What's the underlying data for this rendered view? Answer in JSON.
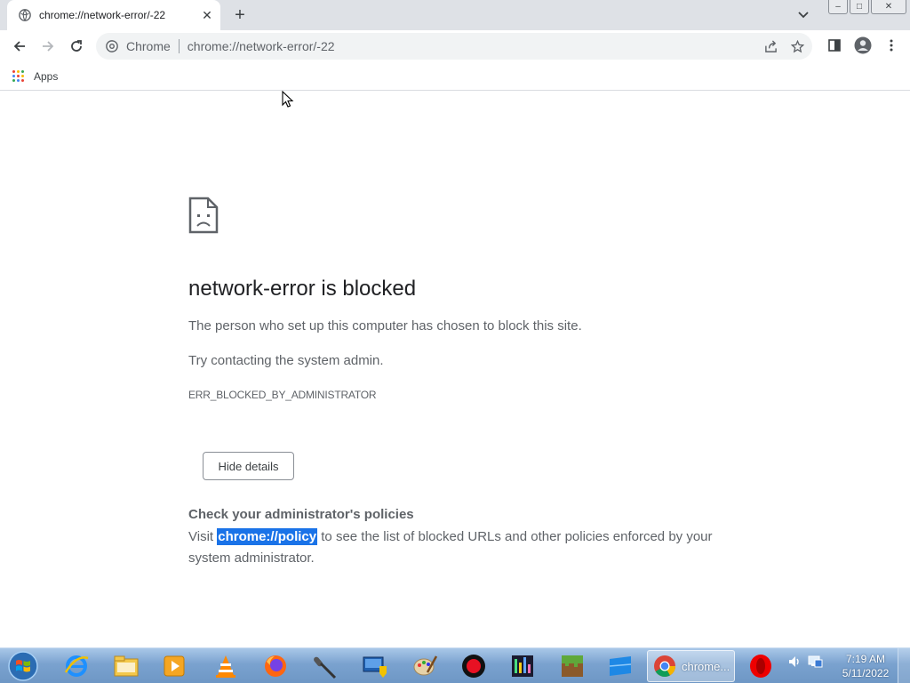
{
  "window": {
    "minimize": "–",
    "maximize": "□",
    "close": "✕"
  },
  "tab": {
    "title": "chrome://network-error/-22",
    "close": "✕",
    "new_tab": "+"
  },
  "omnibox": {
    "chip": "Chrome",
    "url": "chrome://network-error/-22"
  },
  "bookmarks": {
    "apps_label": "Apps"
  },
  "page": {
    "heading": "network-error is blocked",
    "p1": "The person who set up this computer has chosen to block this site.",
    "p2": "Try contacting the system admin.",
    "error_code": "ERR_BLOCKED_BY_ADMINISTRATOR",
    "details_button": "Hide details",
    "details_title": "Check your administrator's policies",
    "details_prefix": "Visit ",
    "details_link": "chrome://policy",
    "details_suffix": " to see the list of blocked URLs and other policies enforced by your system administrator."
  },
  "taskbar": {
    "chrome_label": "chrome...",
    "time": "7:19 AM",
    "date": "5/11/2022"
  },
  "colors": {
    "accent": "#1a73e8",
    "text_primary": "#202124",
    "text_secondary": "#5f6368",
    "tabstrip": "#dee1e6"
  }
}
